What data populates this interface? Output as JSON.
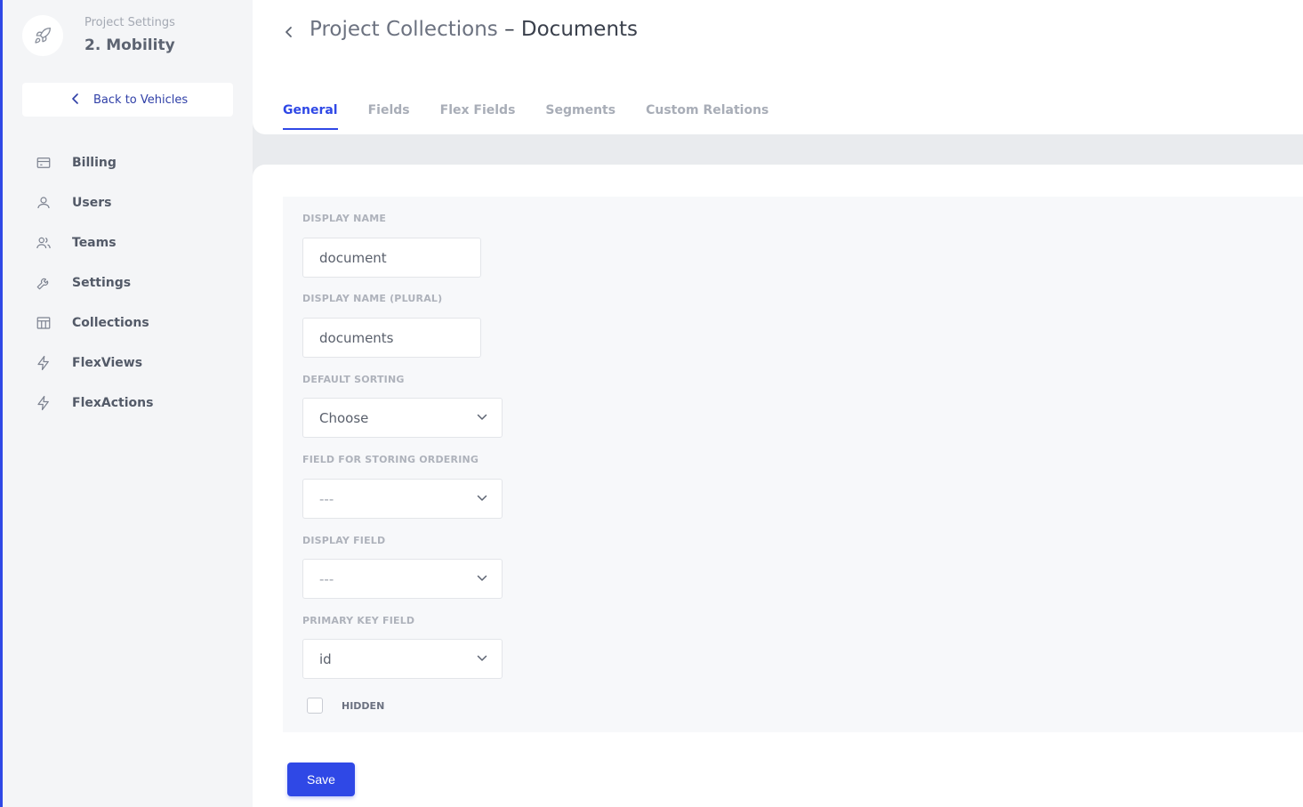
{
  "colors": {
    "accent": "#2f48e6",
    "sidebar_bg": "#f4f5f7",
    "panel_bg": "#f7f8fa"
  },
  "sidebar": {
    "project_sub": "Project Settings",
    "project_name": "2. Mobility",
    "logo_icon": "rocket-icon",
    "back_label": "Back to Vehicles",
    "items": [
      {
        "label": "Billing",
        "icon": "credit-card-icon"
      },
      {
        "label": "Users",
        "icon": "user-icon"
      },
      {
        "label": "Teams",
        "icon": "users-icon"
      },
      {
        "label": "Settings",
        "icon": "wrench-icon"
      },
      {
        "label": "Collections",
        "icon": "table-icon"
      },
      {
        "label": "FlexViews",
        "icon": "bolt-icon"
      },
      {
        "label": "FlexActions",
        "icon": "bolt-icon"
      }
    ]
  },
  "header": {
    "title_parent": "Project Collections",
    "title_sep": " – ",
    "title_current": "Documents",
    "tabs": [
      {
        "label": "General",
        "active": true
      },
      {
        "label": "Fields",
        "active": false
      },
      {
        "label": "Flex Fields",
        "active": false
      },
      {
        "label": "Segments",
        "active": false
      },
      {
        "label": "Custom Relations",
        "active": false
      }
    ]
  },
  "form": {
    "display_name": {
      "label": "DISPLAY NAME",
      "value": "document"
    },
    "display_name_plural": {
      "label": "DISPLAY NAME (PLURAL)",
      "value": "documents"
    },
    "default_sorting": {
      "label": "DEFAULT SORTING",
      "value": "Choose"
    },
    "ordering_field": {
      "label": "FIELD FOR STORING ORDERING",
      "value": "---"
    },
    "display_field": {
      "label": "DISPLAY FIELD",
      "value": "---"
    },
    "primary_key": {
      "label": "PRIMARY KEY FIELD",
      "value": "id"
    },
    "hidden": {
      "label": "HIDDEN",
      "checked": false
    }
  },
  "actions": {
    "save_label": "Save"
  }
}
